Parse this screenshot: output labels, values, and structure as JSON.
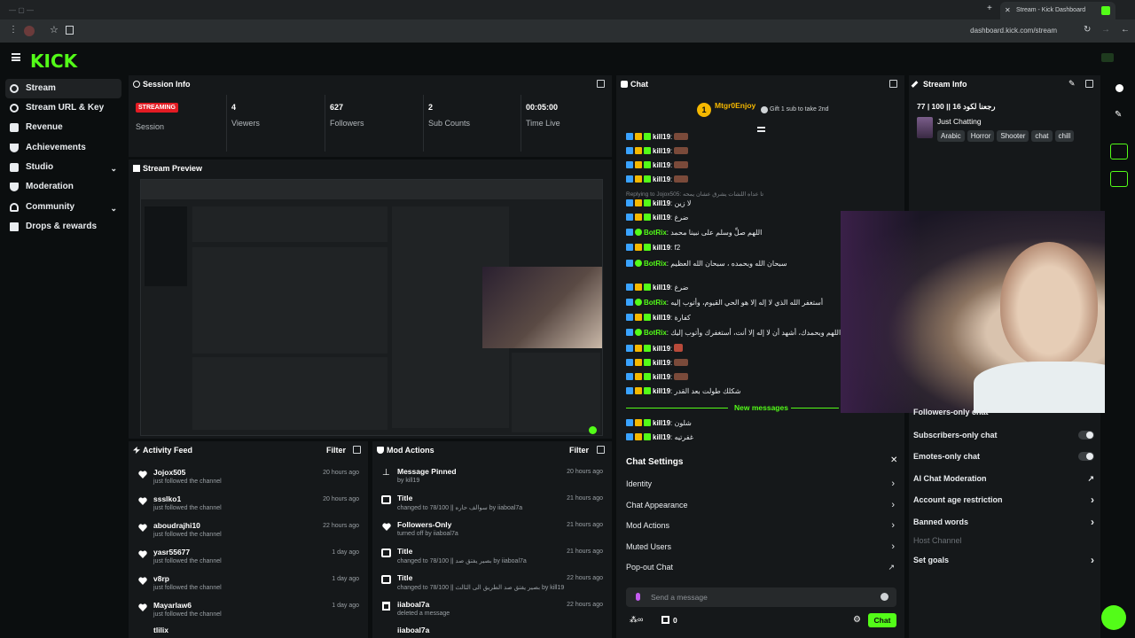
{
  "browser": {
    "tab_title": "Stream - Kick Dashboard",
    "url": "dashboard.kick.com/stream"
  },
  "brand": {
    "logo_text": "KICK",
    "accent": "#53fc18"
  },
  "sidebar": {
    "items": [
      {
        "label": "Stream",
        "icon": "broadcast-icon"
      },
      {
        "label": "Stream URL & Key",
        "icon": "link-icon"
      },
      {
        "label": "Revenue",
        "icon": "dollar-icon"
      },
      {
        "label": "Achievements",
        "icon": "trophy-icon"
      },
      {
        "label": "Studio",
        "icon": "camera-icon"
      },
      {
        "label": "Moderation",
        "icon": "shield-icon"
      },
      {
        "label": "Community",
        "icon": "people-icon"
      },
      {
        "label": "Drops & rewards",
        "icon": "gift-icon"
      }
    ]
  },
  "session": {
    "title": "Session Info",
    "status": "STREAMING",
    "status_label": "Session",
    "stats": [
      {
        "value": "4",
        "label": "Viewers"
      },
      {
        "value": "627",
        "label": "Followers"
      },
      {
        "value": "2",
        "label": "Sub Counts"
      },
      {
        "value": "00:05:00",
        "label": "Time Live"
      }
    ]
  },
  "preview": {
    "title": "Stream Preview"
  },
  "activity": {
    "title": "Activity Feed",
    "filter": "Filter",
    "items": [
      {
        "name": "Jojox505",
        "sub": "just followed the channel",
        "time": "20 hours ago"
      },
      {
        "name": "ssslko1",
        "sub": "just followed the channel",
        "time": "20 hours ago"
      },
      {
        "name": "aboudrajhi10",
        "sub": "just followed the channel",
        "time": "22 hours ago"
      },
      {
        "name": "yasr55677",
        "sub": "just followed the channel",
        "time": "1 day ago"
      },
      {
        "name": "v8rp",
        "sub": "just followed the channel",
        "time": "1 day ago"
      },
      {
        "name": "Mayarlaw6",
        "sub": "just followed the channel",
        "time": "1 day ago"
      },
      {
        "name": "tlilix",
        "sub": "",
        "time": ""
      }
    ]
  },
  "mod": {
    "title": "Mod Actions",
    "filter": "Filter",
    "items": [
      {
        "name": "Message Pinned",
        "sub": "by kill19",
        "time": "20 hours ago"
      },
      {
        "name": "Title",
        "sub": "changed to 78/100 || سوالف حاره by iiaboal7a",
        "time": "21 hours ago"
      },
      {
        "name": "Followers-Only",
        "sub": "turned off by iiaboal7a",
        "time": "21 hours ago"
      },
      {
        "name": "Title",
        "sub": "changed to 78/100 || بصير يفتق صد by iiaboal7a",
        "time": "21 hours ago"
      },
      {
        "name": "Title",
        "sub": "changed to 78/100 || بصير يفتق صد الطريق الى الثالث by kill19",
        "time": "22 hours ago"
      },
      {
        "name": "iiaboal7a",
        "sub": "deleted a message",
        "time": "22 hours ago"
      },
      {
        "name": "iiaboal7a",
        "sub": "",
        "time": ""
      }
    ]
  },
  "chat": {
    "title": "Chat",
    "pinned_user": "Mtgr0Enjoy",
    "pinned_msg": "Gift 1 sub to take 2nd",
    "reply_note": "Replying to Jojox505: تا عداه اللشات يشرق عشان يمحه",
    "lines": [
      {
        "user": "kill19",
        "text": ""
      },
      {
        "user": "kill19",
        "text": ""
      },
      {
        "user": "kill19",
        "text": ""
      },
      {
        "user": "kill19",
        "text": ""
      },
      {
        "user": "kill19",
        "text": "لا زين"
      },
      {
        "user": "kill19",
        "text": "ضرغ"
      },
      {
        "user": "BotRix",
        "text": "اللهم صلِّ وسلم على نبينا محمد"
      },
      {
        "user": "kill19",
        "text": "f2"
      },
      {
        "user": "BotRix",
        "text": "سبحان الله وبحمده ، سبحان الله العظيم"
      },
      {
        "user": "kill19",
        "text": "ضرغ"
      },
      {
        "user": "BotRix",
        "text": "أستغفر الله الذي لا إله إلا هو الحي القيوم، وأتوب إليه"
      },
      {
        "user": "kill19",
        "text": "كفارة"
      },
      {
        "user": "BotRix",
        "text": "سبحانك اللهم وبحمدك، أشهد أن لا إله إلا أنت، أستغفرك وأتوب إليك"
      },
      {
        "user": "kill19",
        "text": ""
      },
      {
        "user": "kill19",
        "text": ""
      },
      {
        "user": "kill19",
        "text": ""
      },
      {
        "user": "kill19",
        "text": "شكلك طولت بعد القدر"
      }
    ],
    "new_messages": "New messages",
    "after_lines": [
      {
        "user": "kill19",
        "text": "شلون"
      },
      {
        "user": "kill19",
        "text": "غفرتيه"
      }
    ],
    "settings_title": "Chat Settings",
    "settings": [
      "Identity",
      "Chat Appearance",
      "Mod Actions",
      "Muted Users",
      "Pop-out Chat"
    ],
    "send_placeholder": "Send a message",
    "counter": "0",
    "chat_button": "Chat"
  },
  "stream_info": {
    "title": "Stream Info",
    "stream_title": "77 | 100 || رجعنا لكود 16",
    "category": "Just Chatting",
    "tags": [
      "Arabic",
      "Horror",
      "Shooter",
      "chat",
      "chill"
    ]
  },
  "right_settings": [
    {
      "label": "Followers-only chat",
      "type": "toggle"
    },
    {
      "label": "Subscribers-only chat",
      "type": "toggle"
    },
    {
      "label": "Emotes-only chat",
      "type": "toggle"
    },
    {
      "label": "AI Chat Moderation",
      "type": "external"
    },
    {
      "label": "Account age restriction",
      "type": "arrow"
    },
    {
      "label": "Banned words",
      "type": "arrow"
    },
    {
      "label": "Host Channel",
      "type": "disabled"
    },
    {
      "label": "Set goals",
      "type": "arrow"
    }
  ]
}
